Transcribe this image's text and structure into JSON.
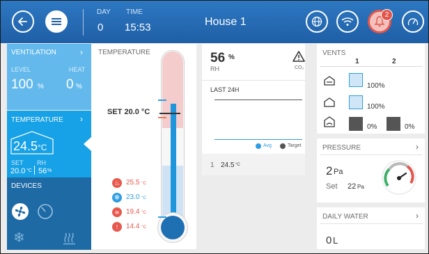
{
  "header": {
    "day_label": "DAY",
    "day_value": "0",
    "time_label": "TIME",
    "time_value": "15:53",
    "house_name": "House 1",
    "alarm_count": "2"
  },
  "ventilation": {
    "title": "VENTILATION",
    "level_label": "LEVEL",
    "level_value": "100",
    "level_unit": "%",
    "heat_label": "HEAT",
    "heat_value": "0",
    "heat_unit": "%"
  },
  "temperature_tile": {
    "title": "TEMPERATURE",
    "current_value": "24.5",
    "current_unit": "°C",
    "set_label": "SET",
    "set_value": "20.0",
    "set_unit": "°C",
    "rh_label": "RH",
    "rh_value": "56",
    "rh_unit": "%"
  },
  "devices": {
    "title": "DEVICES"
  },
  "temperature_panel": {
    "title": "TEMPERATURE",
    "set_label": "SET 20.0 °C",
    "thermometer_fill_fraction": 0.49,
    "legend": [
      {
        "icon": "heat-icon",
        "value": "25.5",
        "unit": "°C",
        "color": "#e7584d"
      },
      {
        "icon": "snowflake-icon",
        "value": "23.0",
        "unit": "°C",
        "color": "#2e9de3"
      },
      {
        "icon": "heater-icon",
        "value": "19.4",
        "unit": "°C",
        "color": "#e7584d"
      },
      {
        "icon": "alarm-icon",
        "value": "14.4",
        "unit": "°C",
        "color": "#e7584d"
      }
    ]
  },
  "humidity_panel": {
    "rh_value": "56",
    "rh_unit": "%",
    "rh_label": "RH",
    "co2_label": "CO₂",
    "last24_label": "LAST 24H",
    "legend_avg": "Avg",
    "legend_target": "Target",
    "bottom_index": "1",
    "bottom_value": "24.5",
    "bottom_unit": "°C"
  },
  "vents": {
    "title": "VENTS",
    "col1": "1",
    "col2": "2",
    "rows": [
      {
        "icon": "inlet-icon",
        "c1": "100%",
        "c2": ""
      },
      {
        "icon": "tunnel-icon",
        "c1": "100%",
        "c2": ""
      },
      {
        "icon": "curtain-icon",
        "c1": "0%",
        "c2": "0%"
      }
    ]
  },
  "pressure": {
    "title": "PRESSURE",
    "value": "2",
    "unit": "Pa",
    "set_label": "Set",
    "set_value": "22",
    "set_unit": "Pa"
  },
  "daily_water": {
    "title": "DAILY WATER",
    "value": "0",
    "unit": "L"
  },
  "colors": {
    "topbar": "#2169b4",
    "ventilation_tile": "#63b9ec",
    "temperature_tile": "#17a1e6",
    "devices_tile": "#1d6aa5",
    "alarm_red": "#e2564c",
    "accent_blue": "#2e9de3"
  }
}
